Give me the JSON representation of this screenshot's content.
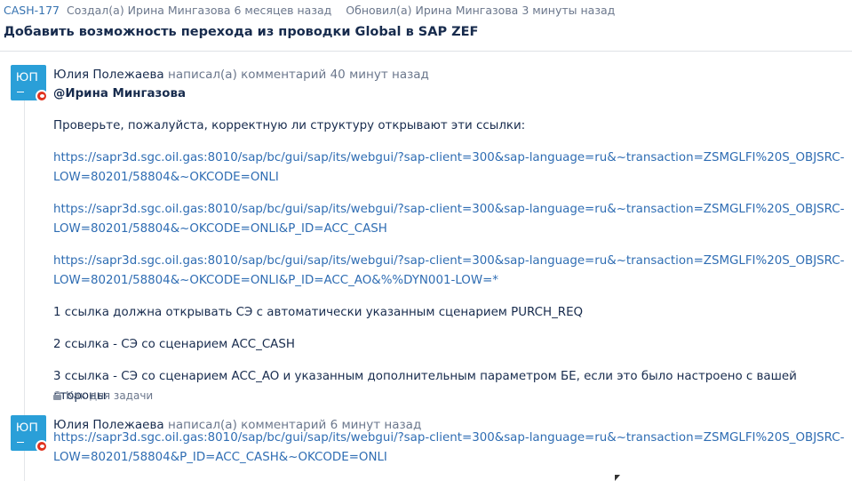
{
  "issue": {
    "key": "CASH-177",
    "created": "Создал(а) Ирина Мингазова 6 месяцев назад",
    "updated": "Обновил(а) Ирина Мингазова 3 минуты назад",
    "title": "Добавить возможность перехода из проводки Global в SAP ZEF"
  },
  "comments": [
    {
      "avatar_initials": "ЮП",
      "author": "Юлия Полежаева",
      "action": "написал(а) комментарий 40 минут назад",
      "mention": "@Ирина Мингазова",
      "intro": "Проверьте, пожалуйста, корректную ли структуру открывают эти ссылки:",
      "links": [
        "https://sapr3d.sgc.oil.gas:8010/sap/bc/gui/sap/its/webgui/?sap-client=300&sap-language=ru&~transaction=ZSMGLFI%20S_OBJSRC-LOW=80201/58804&~OKCODE=ONLI",
        "https://sapr3d.sgc.oil.gas:8010/sap/bc/gui/sap/its/webgui/?sap-client=300&sap-language=ru&~transaction=ZSMGLFI%20S_OBJSRC-LOW=80201/58804&~OKCODE=ONLI&P_ID=ACC_CASH",
        "https://sapr3d.sgc.oil.gas:8010/sap/bc/gui/sap/its/webgui/?sap-client=300&sap-language=ru&~transaction=ZSMGLFI%20S_OBJSRC-LOW=80201/58804&~OKCODE=ONLI&P_ID=ACC_AO&%%DYN001-LOW=*"
      ],
      "notes": [
        "1 ссылка должна открывать СЭ с автоматически указанным сценарием PURCH_REQ",
        "2 ссылка - СЭ со сценарием ACC_CASH",
        "3 ссылка - СЭ со сценарием ACC_AO и указанным дополнительным параметром БЕ, если это было настроено с вашей стороны"
      ],
      "restriction": "Как для задачи"
    },
    {
      "avatar_initials": "ЮП",
      "author": "Юлия Полежаева",
      "action": "написал(а) комментарий 6 минут назад",
      "links": [
        "https://sapr3d.sgc.oil.gas:8010/sap/bc/gui/sap/its/webgui/?sap-client=300&sap-language=ru&~transaction=ZSMGLFI%20S_OBJSRC-LOW=80201/58804&P_ID=ACC_CASH&~OKCODE=ONLI"
      ]
    }
  ],
  "colors": {
    "avatar_bg": "#2a9fd8",
    "link": "#2f6db3",
    "key": "#3572b0",
    "badge": "#e0321e"
  }
}
